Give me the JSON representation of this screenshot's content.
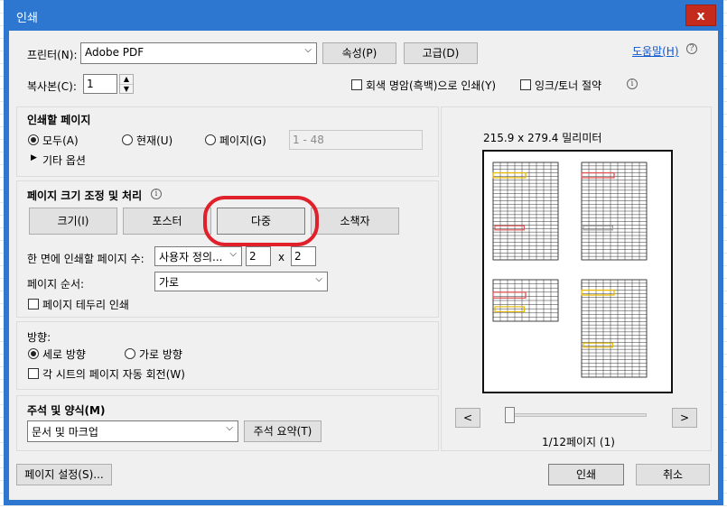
{
  "title": "인쇄",
  "close_label": "x",
  "printer": {
    "label": "프린터(N):",
    "value": "Adobe PDF",
    "properties_button": "속성(P)",
    "advanced_button": "고급(D)",
    "help_link": "도움말(H)"
  },
  "copies": {
    "label": "복사본(C):",
    "value": "1",
    "grayscale_label": "회색 명암(흑백)으로 인쇄(Y)",
    "save_ink_label": "잉크/토너 절약"
  },
  "pages_to_print": {
    "heading": "인쇄할 페이지",
    "all": "모두(A)",
    "current": "현재(U)",
    "pages": "페이지(G)",
    "pages_value": "1 - 48",
    "more_options": "기타 옵션"
  },
  "page_sizing": {
    "heading": "페이지 크기 조정 및 처리",
    "tabs": [
      "크기(I)",
      "포스터",
      "다중",
      "소책자"
    ],
    "pages_per_sheet_label": "한 면에 인쇄할 페이지 수:",
    "pages_per_sheet_value": "사용자 정의...",
    "cols": "2",
    "times": "x",
    "rows": "2",
    "page_order_label": "페이지 순서:",
    "page_order_value": "가로",
    "print_border_label": "페이지 테두리 인쇄"
  },
  "orientation": {
    "heading": "방향:",
    "portrait": "세로 방향",
    "landscape": "가로 방향",
    "auto_rotate": "각 시트의 페이지 자동 회전(W)"
  },
  "comments": {
    "heading": "주석 및 양식(M)",
    "value": "문서 및 마크업",
    "summarize_button": "주석 요약(T)"
  },
  "preview": {
    "dimensions": "215.9 x 279.4 밀리미터",
    "prev": "<",
    "next": ">",
    "page_label": "1/12페이지 (1)",
    "slider_position": 0
  },
  "footer": {
    "page_setup": "페이지 설정(S)...",
    "print": "인쇄",
    "cancel": "취소"
  },
  "accent_colors": {
    "titlebar": "#2e77d0",
    "close": "#c42b1c",
    "highlight": "#e0202a"
  }
}
